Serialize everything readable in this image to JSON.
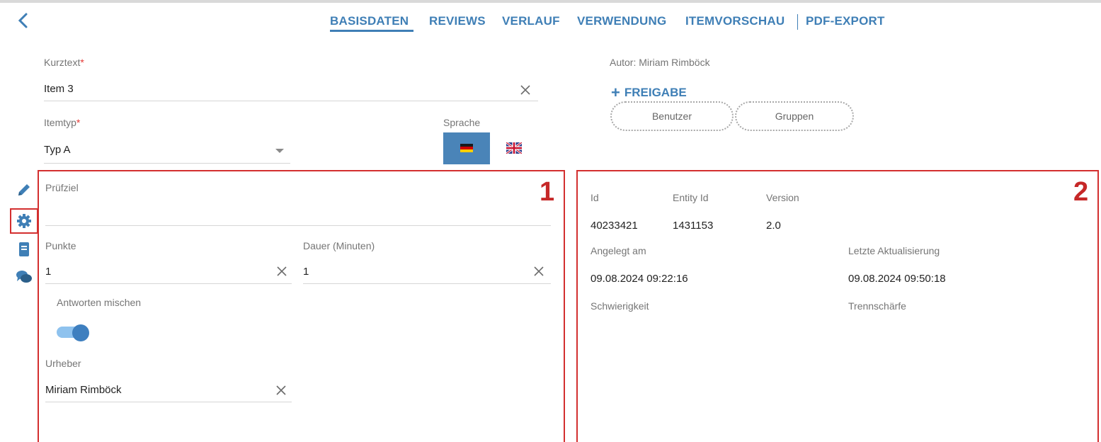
{
  "tabs": [
    "BASISDATEN",
    "REVIEWS",
    "VERLAUF",
    "VERWENDUNG",
    "ITEMVORSCHAU",
    "PDF-EXPORT"
  ],
  "form": {
    "kurztext_label": "Kurztext",
    "kurztext_value": "Item 3",
    "itemtyp_label": "Itemtyp",
    "itemtyp_value": "Typ A",
    "required_mark": "*",
    "sprache_label": "Sprache",
    "selected_language": "de"
  },
  "sharing": {
    "author": "Autor: Miriam Rimböck",
    "freigabe_label": "FREIGABE",
    "chips": [
      "Benutzer",
      "Gruppen"
    ]
  },
  "sidebar": {
    "icons": [
      "pencil-icon",
      "gear-icon",
      "book-icon",
      "comments-icon"
    ],
    "active": "gear-icon"
  },
  "panel1": {
    "number": "1",
    "pruefziel_label": "Prüfziel",
    "pruefziel_value": "",
    "punkte_label": "Punkte",
    "punkte_value": "1",
    "dauer_label": "Dauer (Minuten)",
    "dauer_value": "1",
    "antworten_label": "Antworten mischen",
    "antworten_on": true,
    "urheber_label": "Urheber",
    "urheber_value": "Miriam Rimböck"
  },
  "panel2": {
    "number": "2",
    "id_label": "Id",
    "id_value": "40233421",
    "entity_label": "Entity Id",
    "entity_value": "1431153",
    "version_label": "Version",
    "version_value": "2.0",
    "angelegt_label": "Angelegt am",
    "angelegt_value": "09.08.2024 09:22:16",
    "aktualisierung_label": "Letzte Aktualisierung",
    "aktualisierung_value": "09.08.2024 09:50:18",
    "schwierigkeit_label": "Schwierigkeit",
    "trennschaerfe_label": "Trennschärfe"
  },
  "colors": {
    "accent": "#3f7fb6",
    "highlight_box": "#d32f2f",
    "toggle_on": "#3e7fbf"
  }
}
